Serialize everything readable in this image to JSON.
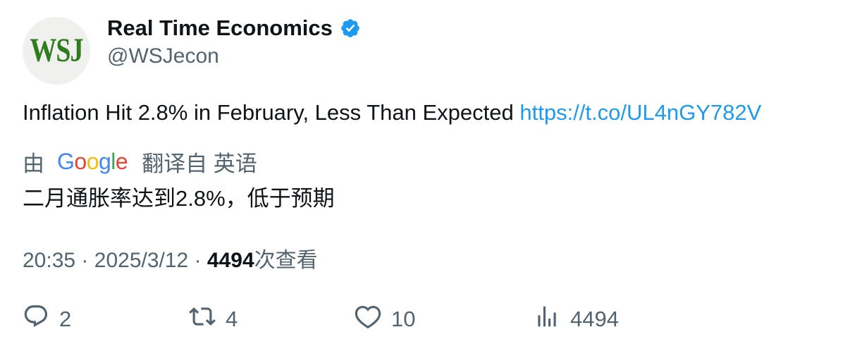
{
  "account": {
    "avatar_text": "WSJ",
    "display_name": "Real Time Economics",
    "handle": "@WSJecon",
    "verified_icon": "verified-badge-icon",
    "brand_color": "#2f7d1f",
    "verified_color": "#1d9bf0"
  },
  "tweet": {
    "text": "Inflation Hit 2.8% in February, Less Than Expected",
    "link": "https://t.co/UL4nGY782V"
  },
  "translation": {
    "prefix": "由",
    "provider_letters": [
      "G",
      "o",
      "o",
      "g",
      "l",
      "e"
    ],
    "suffix": "翻译自 英语",
    "text": "二月通胀率达到2.8%，低于预期"
  },
  "meta": {
    "time": "20:35",
    "separator": "·",
    "date": "2025/3/12",
    "views": "4494",
    "views_label": "次查看"
  },
  "actions": {
    "reply_count": "2",
    "retweet_count": "4",
    "like_count": "10",
    "views_count": "4494"
  }
}
